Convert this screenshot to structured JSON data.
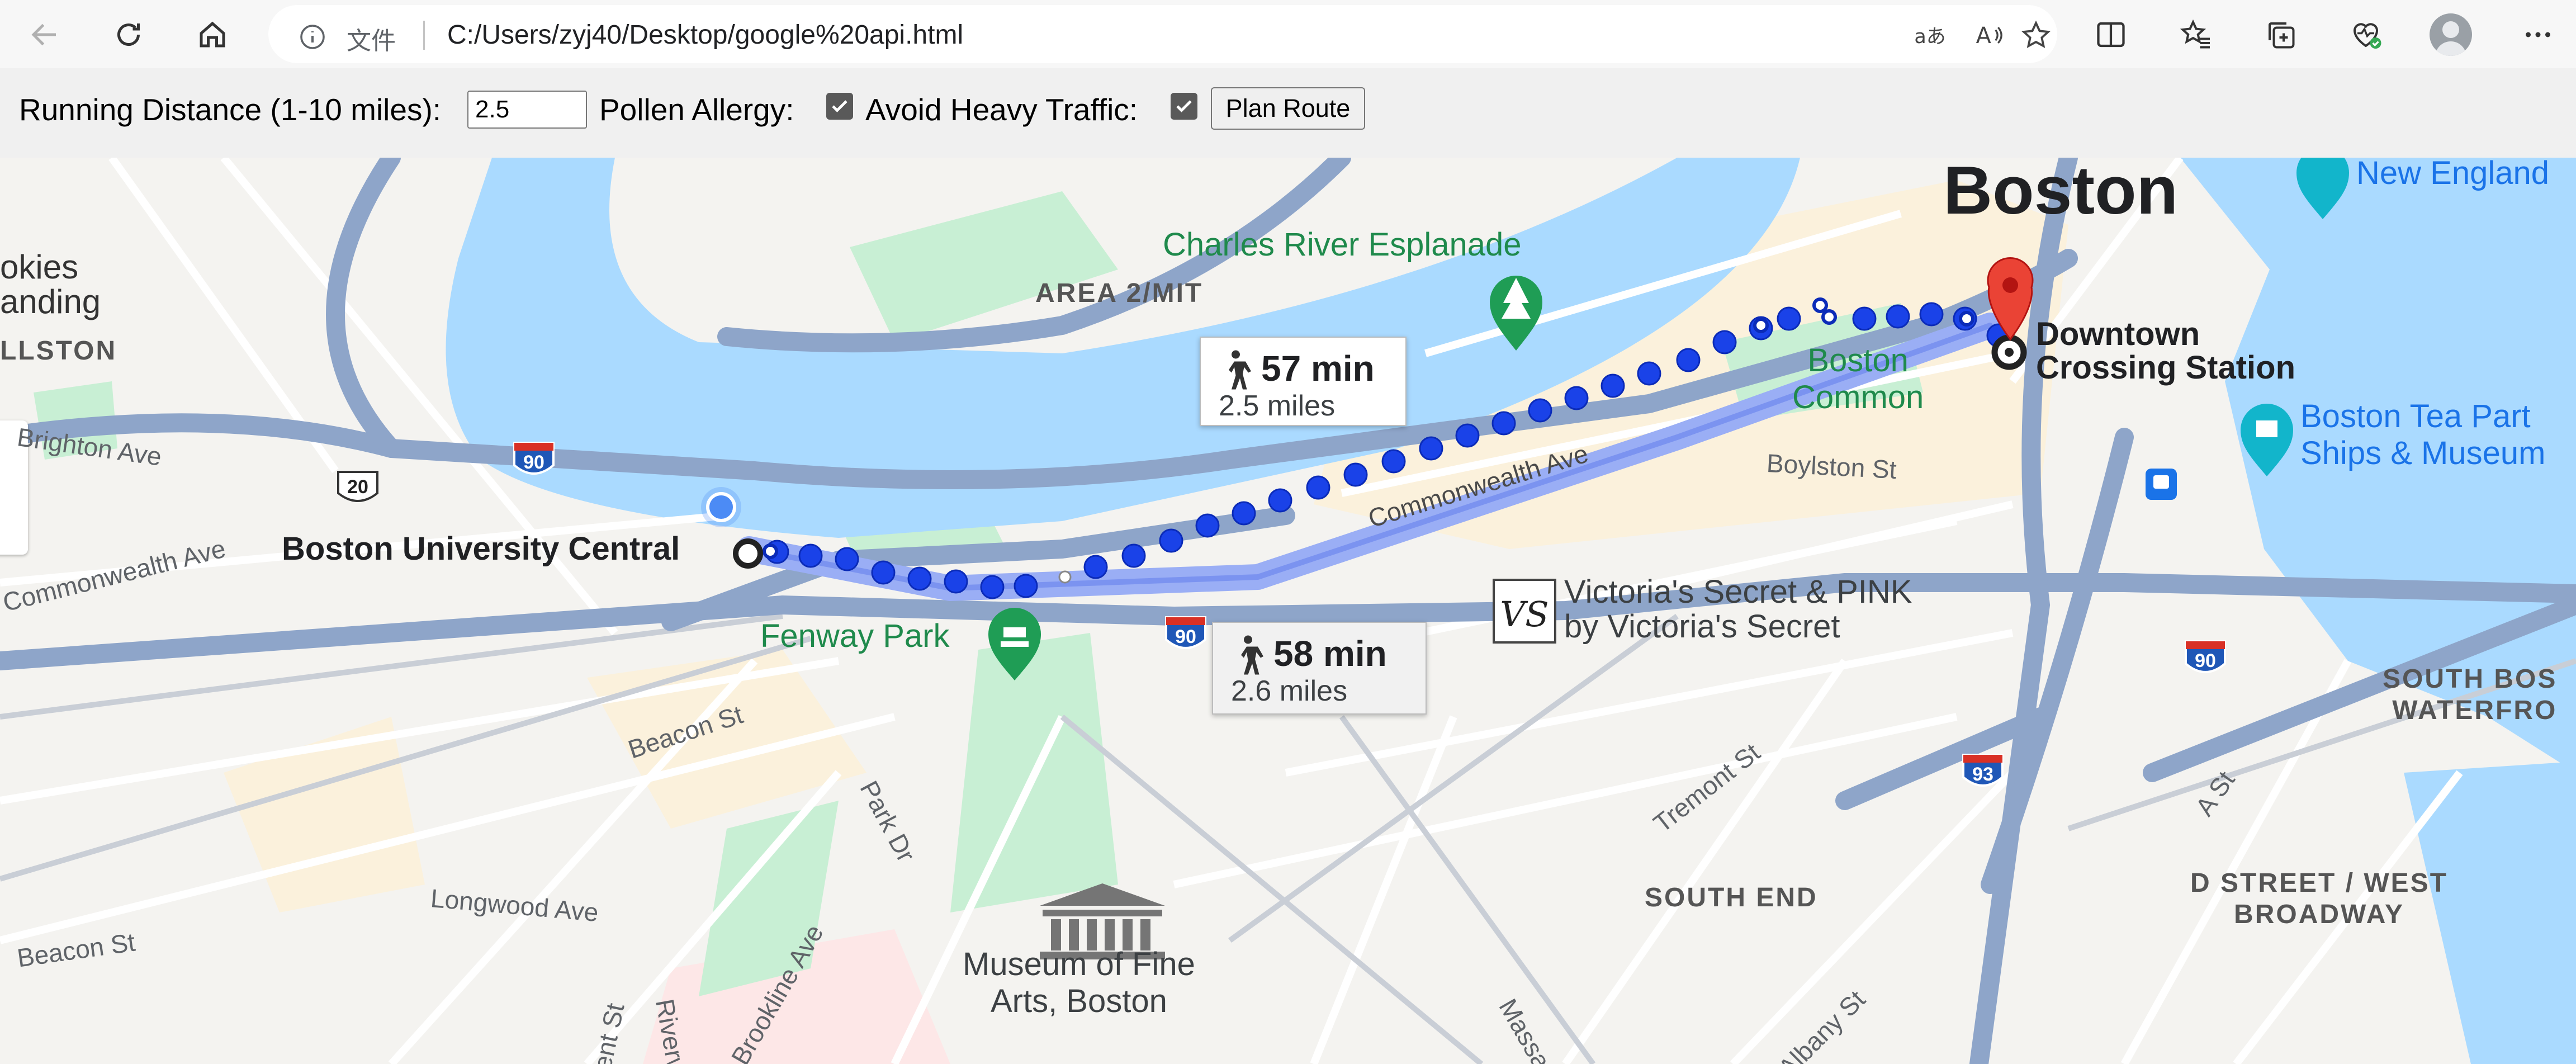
{
  "browser": {
    "chip_text": "文件",
    "url": "C:/Users/zyj40/Desktop/google%20api.html",
    "icons": [
      "back-icon",
      "refresh-icon",
      "home-icon",
      "info-icon",
      "read-aloud-translate-icon",
      "read-aloud-icon",
      "favorite-star-icon",
      "split-screen-icon",
      "favorites-icon",
      "collections-icon",
      "browser-essentials-icon",
      "profile-avatar",
      "more-menu-icon"
    ]
  },
  "controls": {
    "distance_label": "Running Distance (1-10 miles):",
    "distance_value": "2.5",
    "pollen_label": "Pollen Allergy:",
    "pollen_checked": true,
    "traffic_label": "Avoid Heavy Traffic:",
    "traffic_checked": true,
    "plan_button": "Plan Route"
  },
  "map": {
    "labels": {
      "cookies_landing": "okies\nanding",
      "allston": "LLSTON",
      "brighton_ave": "Brighton Ave",
      "commonwealth_ave_w": "Commonwealth Ave",
      "commonwealth_ave": "Commonwealth Ave",
      "boylston_st": "Boylston St",
      "beacon_st_mid": "Beacon St",
      "beacon_st_left": "Beacon St",
      "longwood_ave": "Longwood Ave",
      "brookline_ave": "Brookline Ave",
      "park_dr": "Park Dr",
      "kent_st": "Kent St",
      "riverway": "Riverwa",
      "tremont_st": "Tremont St",
      "albany_st": "Albany St",
      "massachusetts": "Massa",
      "a_st": "A St",
      "area_mit": "AREA 2/MIT",
      "south_end": "SOUTH END",
      "south_boston_waterfront": "SOUTH BOS\nWATERFRO",
      "d_street": "D STREET / WEST\nBROADWAY",
      "boston": "Boston",
      "esplanade": "Charles River Esplanade",
      "boston_common": "Boston\nCommon",
      "fenway_park": "Fenway Park",
      "museum": "Museum of Fine\nArts, Boston",
      "victorias_secret": "Victoria's Secret & PINK\nby Victoria's Secret",
      "new_england": "New England",
      "tea_party": "Boston Tea Part\nShips & Museum",
      "origin": "Boston University Central",
      "destination": "Downtown\nCrossing Station"
    },
    "highway_shields": {
      "i90_a": "90",
      "i90_b": "90",
      "i90_c": "90",
      "us20": "20",
      "i93": "93"
    },
    "route_primary": {
      "time": "57 min",
      "distance": "2.5 miles"
    },
    "route_alternate": {
      "time": "58 min",
      "distance": "2.6 miles"
    },
    "colors": {
      "water": "#aadaff",
      "park": "#c8efd4",
      "highway": "#8ea5c9",
      "route_dots": "#1a42e8",
      "route_alt": "#9aaef5",
      "marker_red": "#ea4335"
    }
  }
}
